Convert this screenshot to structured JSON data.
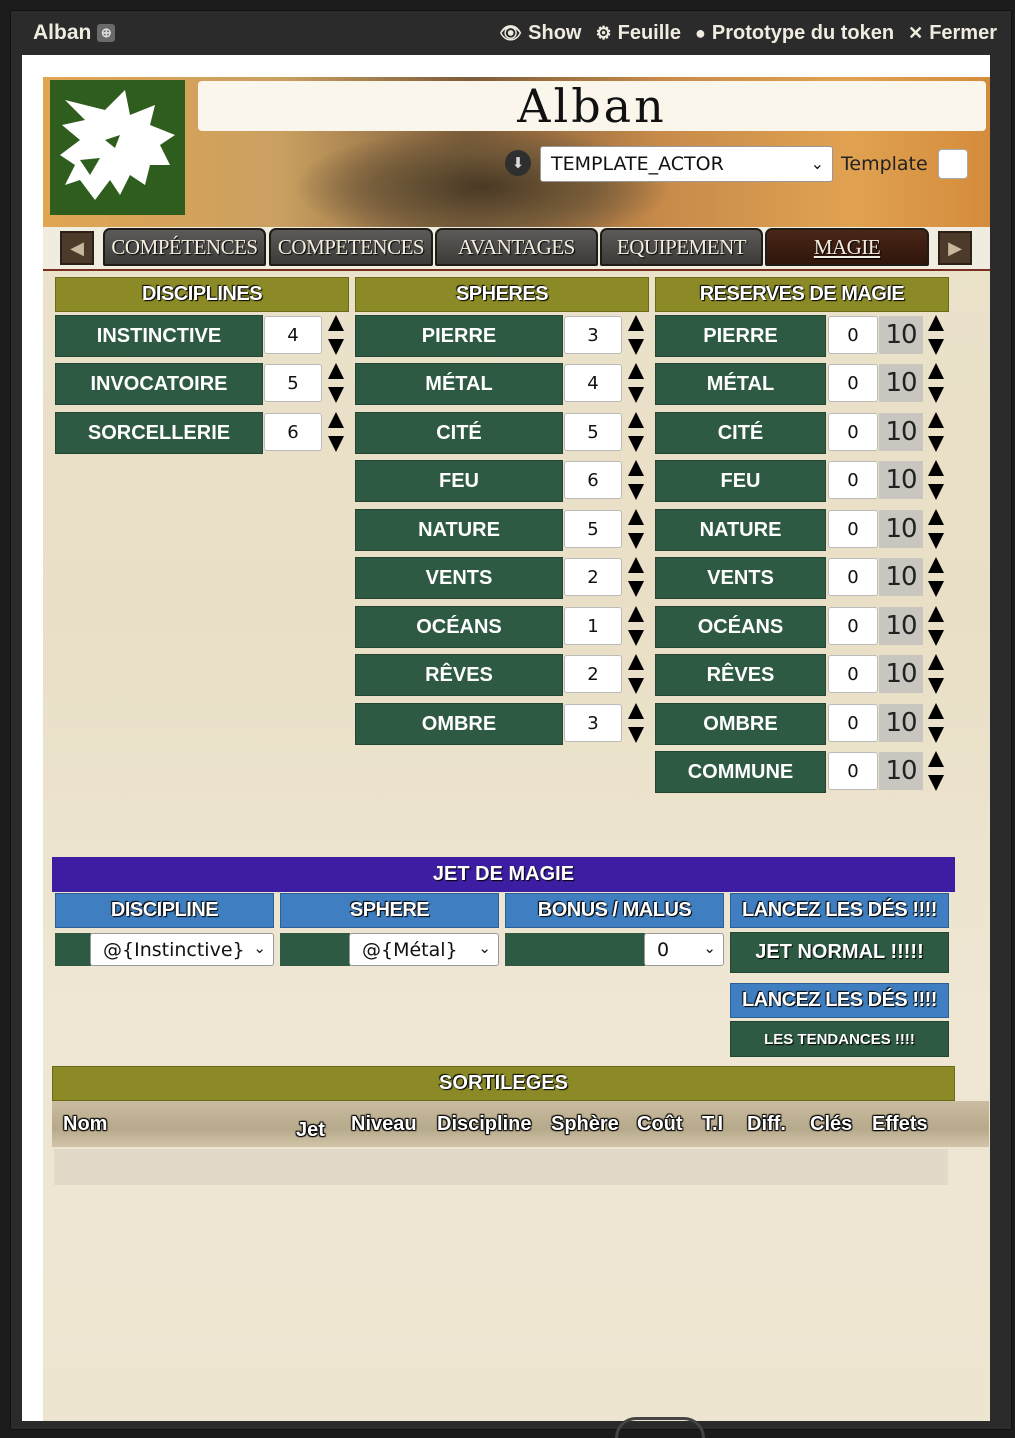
{
  "window": {
    "title": "Alban",
    "controls": [
      {
        "icon": "eye-icon",
        "label": "Show"
      },
      {
        "icon": "gear-icon",
        "label": "Feuille"
      },
      {
        "icon": "user-circle-icon",
        "label": "Prototype du token"
      },
      {
        "icon": "close-icon",
        "label": "Fermer"
      }
    ]
  },
  "header": {
    "name": "Alban",
    "template_select": "TEMPLATE_ACTOR",
    "template_label": "Template"
  },
  "tabs": [
    {
      "label": "COMPÉTENCES"
    },
    {
      "label": "COMPETENCES"
    },
    {
      "label": "AVANTAGES"
    },
    {
      "label": "EQUIPEMENT"
    },
    {
      "label": "MAGIE",
      "active": true
    }
  ],
  "disciplines": {
    "title": "DISCIPLINES",
    "items": [
      {
        "label": "INSTINCTIVE",
        "value": "4"
      },
      {
        "label": "INVOCATOIRE",
        "value": "5"
      },
      {
        "label": "SORCELLERIE",
        "value": "6"
      }
    ]
  },
  "spheres": {
    "title": "SPHERES",
    "items": [
      {
        "label": "PIERRE",
        "value": "3"
      },
      {
        "label": "MÉTAL",
        "value": "4"
      },
      {
        "label": "CITÉ",
        "value": "5"
      },
      {
        "label": "FEU",
        "value": "6"
      },
      {
        "label": "NATURE",
        "value": "5"
      },
      {
        "label": "VENTS",
        "value": "2"
      },
      {
        "label": "OCÉANS",
        "value": "1"
      },
      {
        "label": "RÊVES",
        "value": "2"
      },
      {
        "label": "OMBRE",
        "value": "3"
      }
    ]
  },
  "reserves": {
    "title": "RESERVES DE MAGIE",
    "items": [
      {
        "label": "PIERRE",
        "value": "0",
        "max": "10"
      },
      {
        "label": "MÉTAL",
        "value": "0",
        "max": "10"
      },
      {
        "label": "CITÉ",
        "value": "0",
        "max": "10"
      },
      {
        "label": "FEU",
        "value": "0",
        "max": "10"
      },
      {
        "label": "NATURE",
        "value": "0",
        "max": "10"
      },
      {
        "label": "VENTS",
        "value": "0",
        "max": "10"
      },
      {
        "label": "OCÉANS",
        "value": "0",
        "max": "10"
      },
      {
        "label": "RÊVES",
        "value": "0",
        "max": "10"
      },
      {
        "label": "OMBRE",
        "value": "0",
        "max": "10"
      },
      {
        "label": "COMMUNE",
        "value": "0",
        "max": "10"
      }
    ]
  },
  "jet": {
    "title": "JET DE MAGIE",
    "discipline_header": "DISCIPLINE",
    "sphere_header": "SPHERE",
    "bonus_header": "BONUS / MALUS",
    "roll_header_1": "LANCEZ LES DÉS !!!!",
    "roll_header_2": "LANCEZ LES DÉS !!!!",
    "discipline_select": "@{Instinctive}",
    "sphere_select": "@{Métal}",
    "bonus_select": "0",
    "normal_button": "JET NORMAL !!!!!",
    "tendances_button": "LES TENDANCES !!!!"
  },
  "sortileges": {
    "title": "SORTILEGES",
    "columns": [
      "Nom",
      "Jet",
      "Niveau",
      "Discipline",
      "Sphère",
      "Coût",
      "T.I",
      "Diff.",
      "Clés",
      "Effets"
    ]
  },
  "colors": {
    "olive_header": "#8b8a27",
    "green_cell": "#2e5a43",
    "purple_header": "#3d1da1",
    "blue_header": "#3f7fc1",
    "logo_green": "#2e5d1e"
  }
}
